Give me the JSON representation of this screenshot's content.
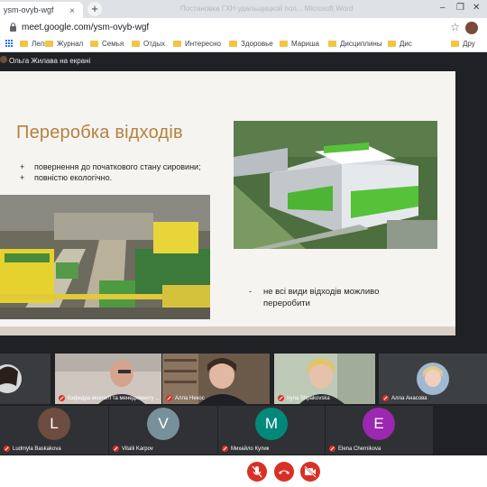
{
  "browser": {
    "tab_title": "ysm-ovyb-wgf",
    "tab_close": "×",
    "new_tab": "+",
    "ghost_tab": "Пocтaновка ГХН удальщицкой пол...   Microsoft Word",
    "url": "meet.google.com/ysm-ovyb-wgf",
    "bookmarks": [
      "Леля",
      "Журнал",
      "Семья",
      "Отдых",
      "Интересно",
      "Здоровье",
      "Мариша",
      "Дисциплины",
      "Дис",
      "Дру"
    ]
  },
  "meet": {
    "presenter_label": "Ольга Жилава на екрані"
  },
  "slide": {
    "title": "Переробка відходів",
    "bullets": [
      "повернення до початкового стану сировини;",
      "повністю екологічно."
    ],
    "bullet_marker": "+",
    "negative_point": "не всі види відходів можливо переробити",
    "negative_marker": "-",
    "accent_color": "#b5813f"
  },
  "participants": {
    "video": [
      {
        "name": "Кафедра екології та менеджменту ..."
      },
      {
        "name": "Алла Некос"
      },
      {
        "name": "Iryna Shpakovska"
      },
      {
        "name": "Алла Анасова"
      }
    ],
    "avatars": [
      {
        "name": "Ludmyla Baskakova",
        "letter": "L",
        "color": "#6d4c41"
      },
      {
        "name": "Vitalii Karpov",
        "letter": "V",
        "color": "#78909c"
      },
      {
        "name": "Михайло Кулик",
        "letter": "M",
        "color": "#00897b"
      },
      {
        "name": "Elena Chernikova",
        "letter": "E",
        "color": "#9c27b0"
      }
    ]
  },
  "icons": {
    "mic": "mic-off-icon",
    "hangup": "hang-up-icon",
    "camera": "camera-off-icon"
  }
}
